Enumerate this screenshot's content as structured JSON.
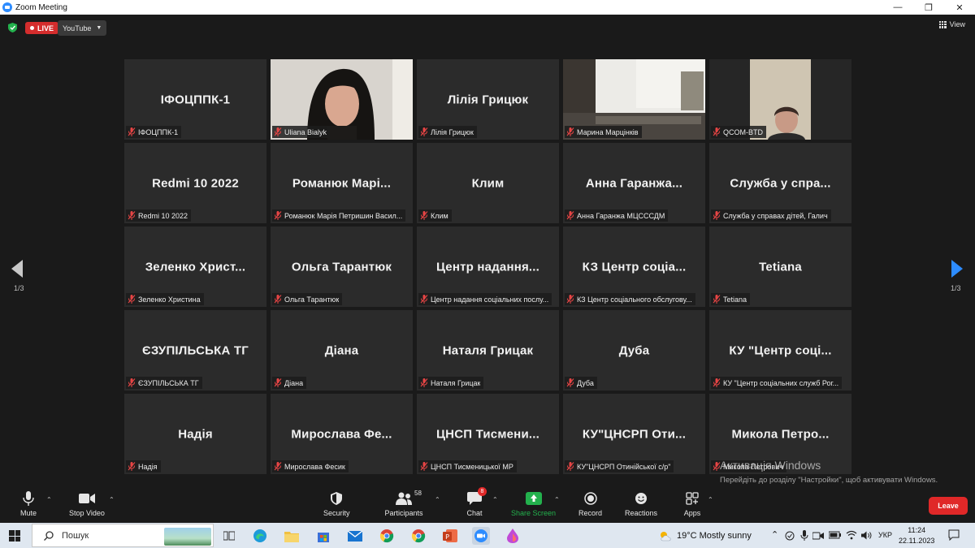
{
  "window": {
    "title": "Zoom Meeting",
    "minimize": "—",
    "restore": "❐",
    "close": "✕"
  },
  "meeting_bar": {
    "live_label": "LIVE",
    "stream_label": "YouTube",
    "view_label": "View"
  },
  "gallery": {
    "page_indicator_left": "1/3",
    "page_indicator_right": "1/3",
    "tiles": [
      {
        "big": "ІФОЦППК-1",
        "label": "ІФОЦППК-1"
      },
      {
        "big": "",
        "label": "Uliana Bialyk"
      },
      {
        "big": "Лілія Грицюк",
        "label": "Лілія Грицюк"
      },
      {
        "big": "",
        "label": "Марина Марцінків"
      },
      {
        "big": "",
        "label": "QCOM-BTD"
      },
      {
        "big": "Redmi 10 2022",
        "label": "Redmi 10 2022"
      },
      {
        "big": "Романюк Марі...",
        "label": "Романюк Марія Петришин Васил..."
      },
      {
        "big": "Клим",
        "label": "Клим"
      },
      {
        "big": "Анна Гаранжа...",
        "label": "Анна Гаранжа МЦСССДМ"
      },
      {
        "big": "Служба у спра...",
        "label": "Служба у справах дітей, Галич"
      },
      {
        "big": "Зеленко Христ...",
        "label": "Зеленко Христина"
      },
      {
        "big": "Ольга Тарантюк",
        "label": "Ольга Тарантюк"
      },
      {
        "big": "Центр надання...",
        "label": "Центр надання соціальних послу..."
      },
      {
        "big": "КЗ Центр соціа...",
        "label": "КЗ Центр соціального обслугову..."
      },
      {
        "big": "Tetiana",
        "label": "Tetiana"
      },
      {
        "big": "ЄЗУПІЛЬСЬКА ТГ",
        "label": "ЄЗУПІЛЬСЬКА ТГ"
      },
      {
        "big": "Діана",
        "label": "Діана"
      },
      {
        "big": "Наталя Грицак",
        "label": "Наталя Грицак"
      },
      {
        "big": "Дуба",
        "label": "Дуба"
      },
      {
        "big": "КУ \"Центр соці...",
        "label": "КУ \"Центр соціальних служб Рог..."
      },
      {
        "big": "Надія",
        "label": "Надія"
      },
      {
        "big": "Мирослава Фе...",
        "label": "Мирослава Фесик"
      },
      {
        "big": "ЦНСП Тисмени...",
        "label": "ЦНСП Тисменицької МР"
      },
      {
        "big": "КУ\"ЦНСРП Оти...",
        "label": "КУ\"ЦНСРП Отинійської с/р\""
      },
      {
        "big": "Микола Петро...",
        "label": "Микола Петрович"
      }
    ]
  },
  "toolbar": {
    "mute": "Mute",
    "stop_video": "Stop Video",
    "security": "Security",
    "participants": "Participants",
    "participants_count": "58",
    "chat": "Chat",
    "chat_badge": "8",
    "share_screen": "Share Screen",
    "record": "Record",
    "reactions": "Reactions",
    "apps": "Apps",
    "leave": "Leave"
  },
  "activation": {
    "title": "Активація Windows",
    "subtitle": "Перейдіть до розділу \"Настройки\", щоб активувати Windows."
  },
  "taskbar": {
    "search_placeholder": "Пошук",
    "weather": "19°C  Mostly sunny",
    "language": "УКР",
    "time": "11:24",
    "date": "22.11.2023"
  },
  "colors": {
    "zoom_blue": "#2d8cff",
    "live_red": "#d42d2d",
    "leave_red": "#e02828",
    "active_speaker": "#c3d63a",
    "share_green": "#23b14d",
    "tile_bg": "#2b2b2b"
  }
}
